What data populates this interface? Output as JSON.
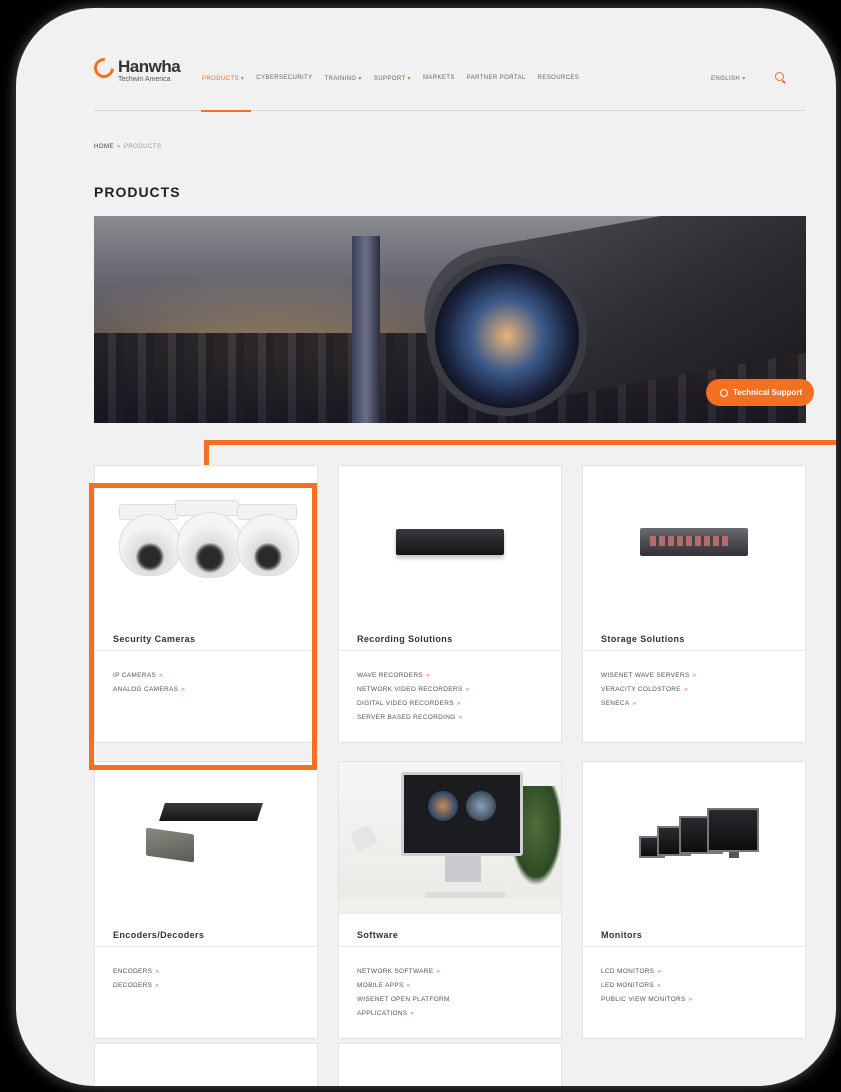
{
  "nav": {
    "logo_name": "Hanwha",
    "logo_sub": "Techwin America",
    "items": [
      {
        "label": "PRODUCTS",
        "caret": "▾",
        "active": true
      },
      {
        "label": "CYBERSECURITY"
      },
      {
        "label": "TRAINING",
        "caret": "▾"
      },
      {
        "label": "SUPPORT",
        "caret": "▾"
      },
      {
        "label": "MARKETS"
      },
      {
        "label": "PARTNER PORTAL"
      },
      {
        "label": "RESOURCES"
      }
    ],
    "language": "ENGLISH",
    "language_caret": "▾",
    "accent_color": "#f37021"
  },
  "breadcrumb": {
    "home": "HOME",
    "separator": "»",
    "current": "PRODUCTS"
  },
  "page_title": "PRODUCTS",
  "support_button": {
    "label": "Technical Support",
    "icon": "chat-bubble-icon"
  },
  "cards": [
    {
      "title": "Security Cameras",
      "links": [
        "IP CAMERAS",
        "ANALOG CAMERAS"
      ],
      "image": "dome-cameras",
      "highlighted": true
    },
    {
      "title": "Recording Solutions",
      "links": [
        "WAVE RECORDERS",
        "NETWORK VIDEO RECORDERS",
        "DIGITAL VIDEO RECORDERS",
        "SERVER BASED RECORDING"
      ],
      "image": "nvr"
    },
    {
      "title": "Storage Solutions",
      "links": [
        "WISENET WAVE SERVERS",
        "VERACITY COLDSTORE",
        "SENECA"
      ],
      "image": "rack-server"
    },
    {
      "title": "Encoders/Decoders",
      "links": [
        "ENCODERS",
        "DECODERS"
      ],
      "image": "encoders"
    },
    {
      "title": "Software",
      "links": [
        "NETWORK SOFTWARE",
        "MOBILE APPS",
        "WISENET OPEN PLATFORM",
        "APPLICATIONS"
      ],
      "image": "software-desk"
    },
    {
      "title": "Monitors",
      "links": [
        "LCD MONITORS",
        "LED MONITORS",
        "PUBLIC VIEW MONITORS"
      ],
      "image": "monitors"
    }
  ],
  "link_arrow": "»"
}
